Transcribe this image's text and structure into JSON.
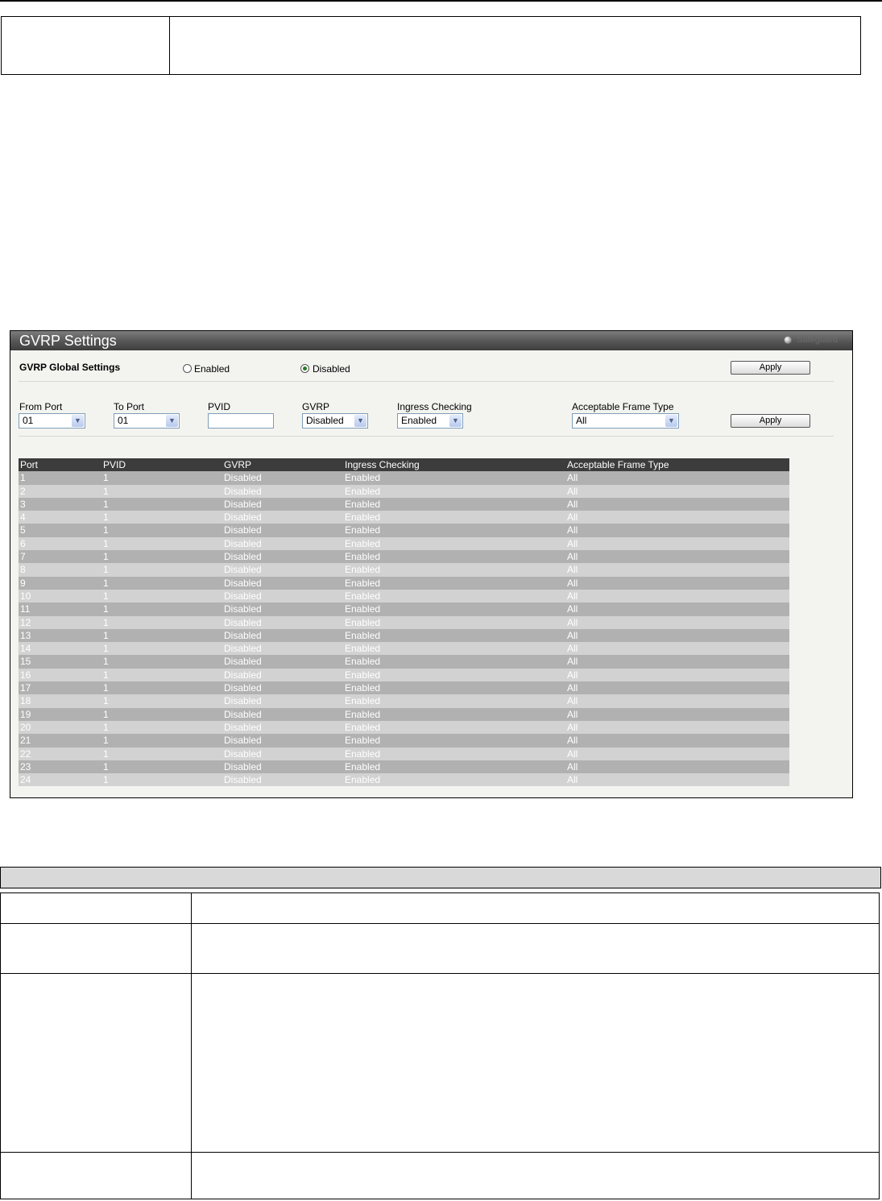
{
  "panel": {
    "title": "GVRP Settings",
    "safeguard_label": "Safeguard",
    "global": {
      "label": "GVRP Global Settings",
      "enabled_label": "Enabled",
      "disabled_label": "Disabled",
      "selected": "Disabled",
      "apply_label": "Apply"
    },
    "port_form": {
      "from_port_label": "From Port",
      "from_port_value": "01",
      "to_port_label": "To Port",
      "to_port_value": "01",
      "pvid_label": "PVID",
      "pvid_value": "",
      "gvrp_label": "GVRP",
      "gvrp_value": "Disabled",
      "ingress_label": "Ingress Checking",
      "ingress_value": "Enabled",
      "aft_label": "Acceptable Frame Type",
      "aft_value": "All",
      "apply_label": "Apply"
    },
    "table": {
      "headers": [
        "Port",
        "PVID",
        "GVRP",
        "Ingress Checking",
        "Acceptable Frame Type"
      ],
      "rows": [
        [
          "1",
          "1",
          "Disabled",
          "Enabled",
          "All"
        ],
        [
          "2",
          "1",
          "Disabled",
          "Enabled",
          "All"
        ],
        [
          "3",
          "1",
          "Disabled",
          "Enabled",
          "All"
        ],
        [
          "4",
          "1",
          "Disabled",
          "Enabled",
          "All"
        ],
        [
          "5",
          "1",
          "Disabled",
          "Enabled",
          "All"
        ],
        [
          "6",
          "1",
          "Disabled",
          "Enabled",
          "All"
        ],
        [
          "7",
          "1",
          "Disabled",
          "Enabled",
          "All"
        ],
        [
          "8",
          "1",
          "Disabled",
          "Enabled",
          "All"
        ],
        [
          "9",
          "1",
          "Disabled",
          "Enabled",
          "All"
        ],
        [
          "10",
          "1",
          "Disabled",
          "Enabled",
          "All"
        ],
        [
          "11",
          "1",
          "Disabled",
          "Enabled",
          "All"
        ],
        [
          "12",
          "1",
          "Disabled",
          "Enabled",
          "All"
        ],
        [
          "13",
          "1",
          "Disabled",
          "Enabled",
          "All"
        ],
        [
          "14",
          "1",
          "Disabled",
          "Enabled",
          "All"
        ],
        [
          "15",
          "1",
          "Disabled",
          "Enabled",
          "All"
        ],
        [
          "16",
          "1",
          "Disabled",
          "Enabled",
          "All"
        ],
        [
          "17",
          "1",
          "Disabled",
          "Enabled",
          "All"
        ],
        [
          "18",
          "1",
          "Disabled",
          "Enabled",
          "All"
        ],
        [
          "19",
          "1",
          "Disabled",
          "Enabled",
          "All"
        ],
        [
          "20",
          "1",
          "Disabled",
          "Enabled",
          "All"
        ],
        [
          "21",
          "1",
          "Disabled",
          "Enabled",
          "All"
        ],
        [
          "22",
          "1",
          "Disabled",
          "Enabled",
          "All"
        ],
        [
          "23",
          "1",
          "Disabled",
          "Enabled",
          "All"
        ],
        [
          "24",
          "1",
          "Disabled",
          "Enabled",
          "All"
        ]
      ]
    }
  }
}
